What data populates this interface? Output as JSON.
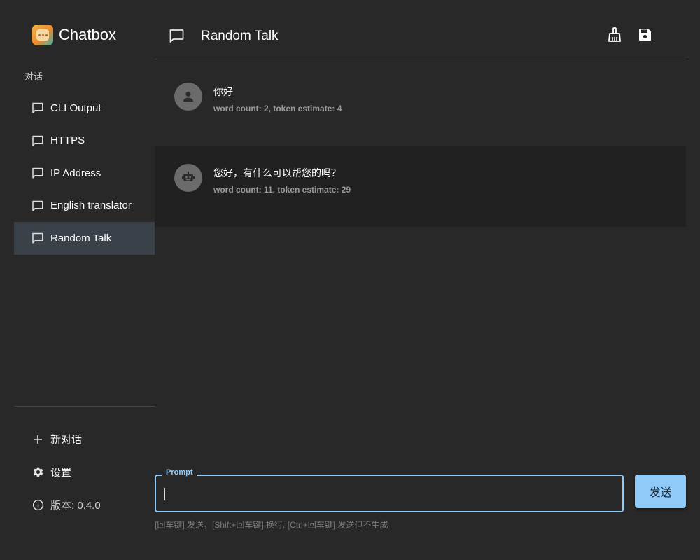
{
  "app": {
    "name": "Chatbox"
  },
  "sidebar": {
    "section_label": "对话",
    "conversations": [
      {
        "label": "CLI Output"
      },
      {
        "label": "HTTPS"
      },
      {
        "label": "IP Address"
      },
      {
        "label": "English translator"
      },
      {
        "label": "Random Talk",
        "active": true
      }
    ],
    "bottom": {
      "new_chat": "新对话",
      "settings": "设置",
      "version": "版本: 0.4.0"
    }
  },
  "header": {
    "title": "Random Talk"
  },
  "messages": [
    {
      "role": "user",
      "text": "你好",
      "meta": "word count: 2, token estimate: 4"
    },
    {
      "role": "assistant",
      "text": "您好，有什么可以帮您的吗？",
      "meta": "word count: 11, token estimate: 29"
    }
  ],
  "input": {
    "label": "Prompt",
    "value": "",
    "send_label": "发送",
    "hint": "[回车键] 发送，[Shift+回车键] 换行, [Ctrl+回车键] 发送但不生成"
  },
  "colors": {
    "background": "#282828",
    "active_item": "#3b4148",
    "accent": "#90caf9",
    "assistant_row": "#212121"
  }
}
